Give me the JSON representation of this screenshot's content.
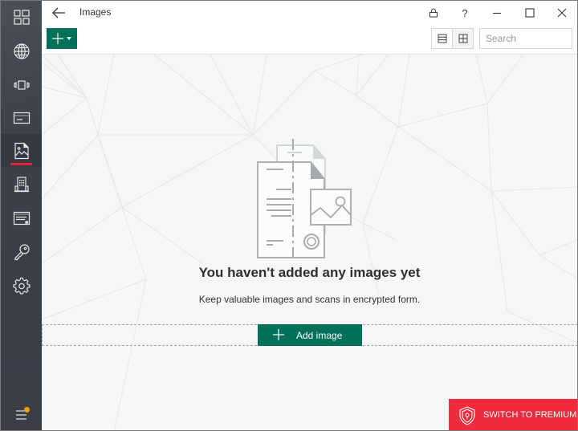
{
  "window": {
    "title": "Images",
    "controls": {
      "lock": "lock-icon",
      "help": "?",
      "minimize": "minimize-icon",
      "maximize": "maximize-icon",
      "close": "close-icon"
    }
  },
  "sidebar": {
    "items": [
      {
        "id": "dashboard",
        "icon": "dashboard-icon"
      },
      {
        "id": "websites",
        "icon": "globe-icon"
      },
      {
        "id": "applications",
        "icon": "app-icon"
      },
      {
        "id": "bank-cards",
        "icon": "card-icon"
      },
      {
        "id": "images",
        "icon": "image-file-icon",
        "active": true
      },
      {
        "id": "addresses",
        "icon": "building-icon"
      },
      {
        "id": "notes",
        "icon": "notes-icon"
      },
      {
        "id": "password-generator",
        "icon": "key-icon"
      },
      {
        "id": "settings",
        "icon": "gear-icon"
      }
    ],
    "menu": {
      "icon": "menu-icon",
      "has_notification": true
    },
    "active_indicator_color": "#e8232f",
    "notification_color": "#f5a000"
  },
  "toolbar": {
    "add_button": {
      "icon": "plus-icon",
      "dropdown": "caret-down-icon"
    },
    "view_list": "list-view-icon",
    "view_grid": "grid-view-icon",
    "search_placeholder": "Search",
    "search_value": ""
  },
  "empty_state": {
    "title": "You haven't added any images yet",
    "subtitle": "Keep valuable images and scans in encrypted form.",
    "add_button_label": "Add image"
  },
  "premium": {
    "label": "SWITCH TO PREMIUM",
    "color": "#ef2b3d"
  },
  "colors": {
    "accent": "#00705a",
    "sidebar": "#3c4049",
    "content_bg": "#f6f6f6"
  }
}
